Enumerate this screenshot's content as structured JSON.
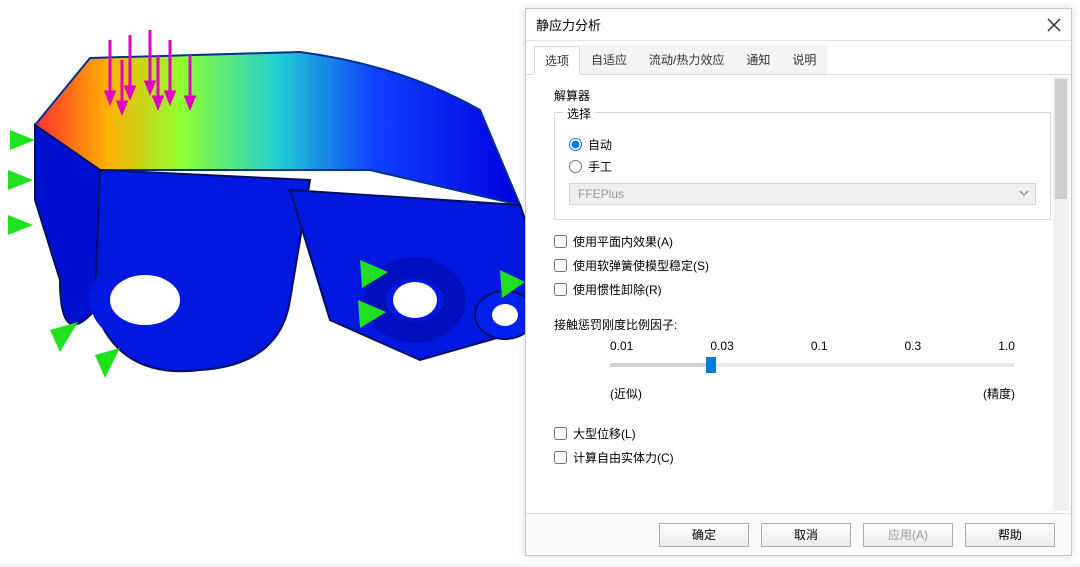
{
  "dialog": {
    "title": "静应力分析"
  },
  "tabs": [
    "选项",
    "自适应",
    "流动/热力效应",
    "通知",
    "说明"
  ],
  "active_tab_index": 0,
  "solver": {
    "group_title": "解算器",
    "select_label": "选择",
    "radio_auto": "自动",
    "radio_manual": "手工",
    "combo_value": "FFEPlus"
  },
  "checks1": {
    "planar": "使用平面内效果(A)",
    "softspring": "使用软弹簧使模型稳定(S)",
    "inertial": "使用惯性卸除(R)"
  },
  "slider": {
    "label": "接触惩罚刚度比例因子:",
    "ticks": [
      "0.01",
      "0.03",
      "0.1",
      "0.3",
      "1.0"
    ],
    "left_label": "(近似)",
    "right_label": "(精度)"
  },
  "checks2": {
    "large_disp": "大型位移(L)",
    "free_body": "计算自由实体力(C)"
  },
  "buttons": {
    "ok": "确定",
    "cancel": "取消",
    "apply": "应用(A)",
    "help": "帮助"
  }
}
